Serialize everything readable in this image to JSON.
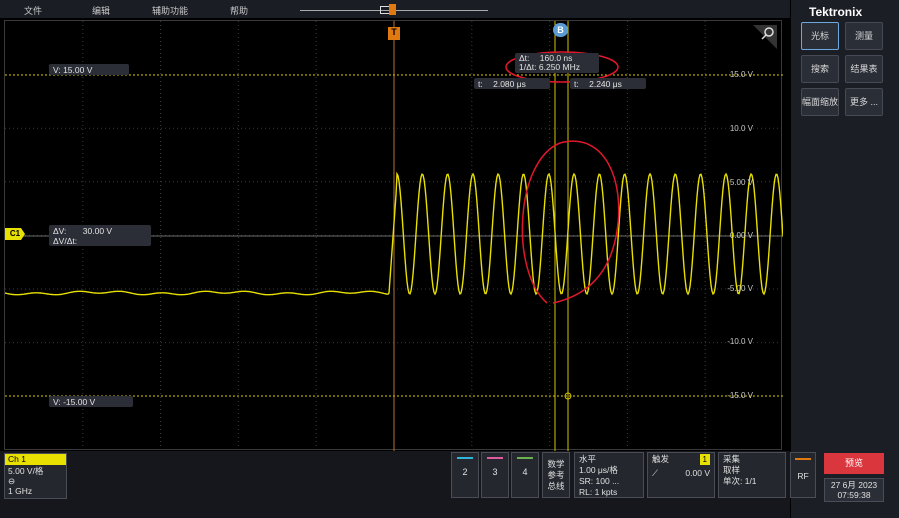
{
  "menubar": {
    "items": [
      "文件",
      "编辑",
      "辅助功能",
      "帮助"
    ]
  },
  "brand": {
    "logo": "Tektronix"
  },
  "right_panel": {
    "buttons": [
      {
        "label": "光标",
        "active": true
      },
      {
        "label": "测量"
      },
      {
        "label": "搜索"
      },
      {
        "label": "结果表"
      },
      {
        "label": "幅面缩放"
      },
      {
        "label": "更多 ..."
      }
    ]
  },
  "cursor_readouts": {
    "v1": "V:   15.00 V",
    "v2": "V:  -15.00 V",
    "dv_label": "ΔV:",
    "dv_value": "30.00 V",
    "dvdt": "ΔV/Δt:",
    "dt_label": "Δt:",
    "dt_value": "160.0 ns",
    "inv_dt_label": "1/Δt:",
    "inv_dt_value": "6.250 MHz",
    "t1_label": "t:",
    "t1_value": "2.080 μs",
    "t2_label": "t:",
    "t2_value": "2.240 μs"
  },
  "markers": {
    "trigger": "T",
    "cursor_b": "B",
    "channel": "C1"
  },
  "y_axis_labels": [
    "15.0 V",
    "10.0 V",
    "5.00 V",
    "0.00 V",
    "-5.00 V",
    "-10.0 V",
    "-15.0 V"
  ],
  "ch1": {
    "name": "Ch 1",
    "scale": "5.00 V/格",
    "bw": "1 GHz"
  },
  "channel_buttons": [
    "2",
    "3",
    "4"
  ],
  "math": {
    "label": "数学\n参考\n总线"
  },
  "horizontal": {
    "title": "水平",
    "scale": "1.00 μs/格",
    "sr": "SR: 100 ...",
    "rl": "RL: 1 kpts"
  },
  "trigger": {
    "title": "触发",
    "badge": "1",
    "level": "0.00 V"
  },
  "acquire": {
    "title": "采集",
    "mode": "取样",
    "count": "单次: 1/1"
  },
  "rf": {
    "label": "RF"
  },
  "run": {
    "label": "预览"
  },
  "datetime": {
    "date": "27 6月 2023",
    "time": "07:59:38"
  },
  "colors": {
    "ch1": "#e8e000",
    "annotation": "#e0182a",
    "accent": "#6ea8e0",
    "run": "#d9363e"
  }
}
